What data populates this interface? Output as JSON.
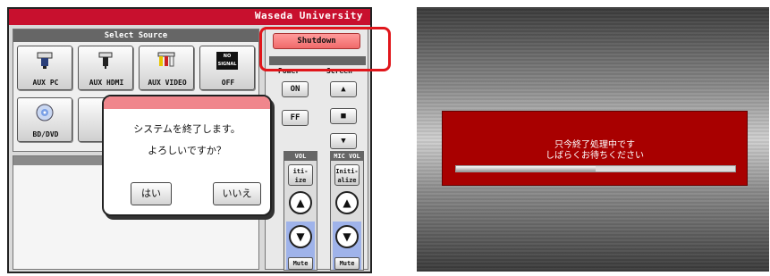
{
  "topbar": {
    "org": "Waseda University"
  },
  "source_panel": {
    "title": "Select Source",
    "sources": [
      {
        "label": "AUX PC",
        "icon": "pc-connector-icon"
      },
      {
        "label": "AUX HDMI",
        "icon": "hdmi-connector-icon"
      },
      {
        "label": "AUX VIDEO",
        "icon": "rca-connector-icon"
      },
      {
        "label": "OFF",
        "icon": "no-signal-icon",
        "icon_text": "NO SIGNAL"
      },
      {
        "label": "BD/DVD",
        "icon": "disc-icon"
      }
    ]
  },
  "controls": {
    "shutdown_label": "Shutdown",
    "projector": {
      "power_label": "Power",
      "screen_label": "Screen",
      "on_label": "ON",
      "off_label": "FF"
    },
    "vol_label": "VOL",
    "mic_vol_label": "MIC VOL",
    "initialize_label": "Initi-\nalize",
    "initialize_partial": "iti-\nize",
    "mute_label": "Mute"
  },
  "dialog": {
    "line1": "システムを終了します。",
    "line2": "よろしいですか？",
    "yes_label": "はい",
    "no_label": "いいえ"
  },
  "busy_screen": {
    "line1": "只今終了処理中です",
    "line2": "しばらくお待ちください",
    "progress": 0.5
  },
  "colors": {
    "accent": "#c8102e",
    "highlight": "#e0161b",
    "busy_bg": "#a80000"
  }
}
